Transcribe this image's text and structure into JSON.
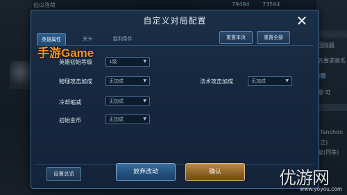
{
  "background": {
    "top_left_text": "仙山洛荷",
    "top_nums": "79494",
    "top_nums_2": "73594",
    "right_texts": [
      "国际服",
      "名要求高低",
      "都 可",
      "(Tanchon",
      "(正)",
      "复(同等)"
    ],
    "link_text": "调整"
  },
  "dialog": {
    "title": "自定义对局配置",
    "tabs": [
      {
        "label": "英雄属性",
        "active": true
      },
      {
        "label": "关卡",
        "active": false
      },
      {
        "label": "胜利条件",
        "active": false
      }
    ],
    "reset_page_label": "重置本页",
    "reset_all_label": "重置全部",
    "fields": {
      "hero_level": {
        "label": "英雄初始等级",
        "value": "1级"
      },
      "physical_attack": {
        "label": "物理攻击加成",
        "value": "无加成"
      },
      "magic_attack": {
        "label": "法术攻击加成",
        "value": "无加成"
      },
      "cooldown": {
        "label": "冷却缩减",
        "value": "无加成"
      },
      "gold": {
        "label": "初始金币",
        "value": "无加成"
      }
    },
    "settings_summary_label": "设置总览",
    "discard_label": "放弃改动",
    "confirm_label": "确认"
  },
  "watermark": "手游Game",
  "site_logo": {
    "text": "优游网",
    "url": "www.yoyou.com"
  },
  "colors": {
    "dialog_bg": "#162840",
    "accent_blue": "#2c5d8d",
    "confirm_gold": "#b98c47",
    "watermark": "#f7941d"
  }
}
